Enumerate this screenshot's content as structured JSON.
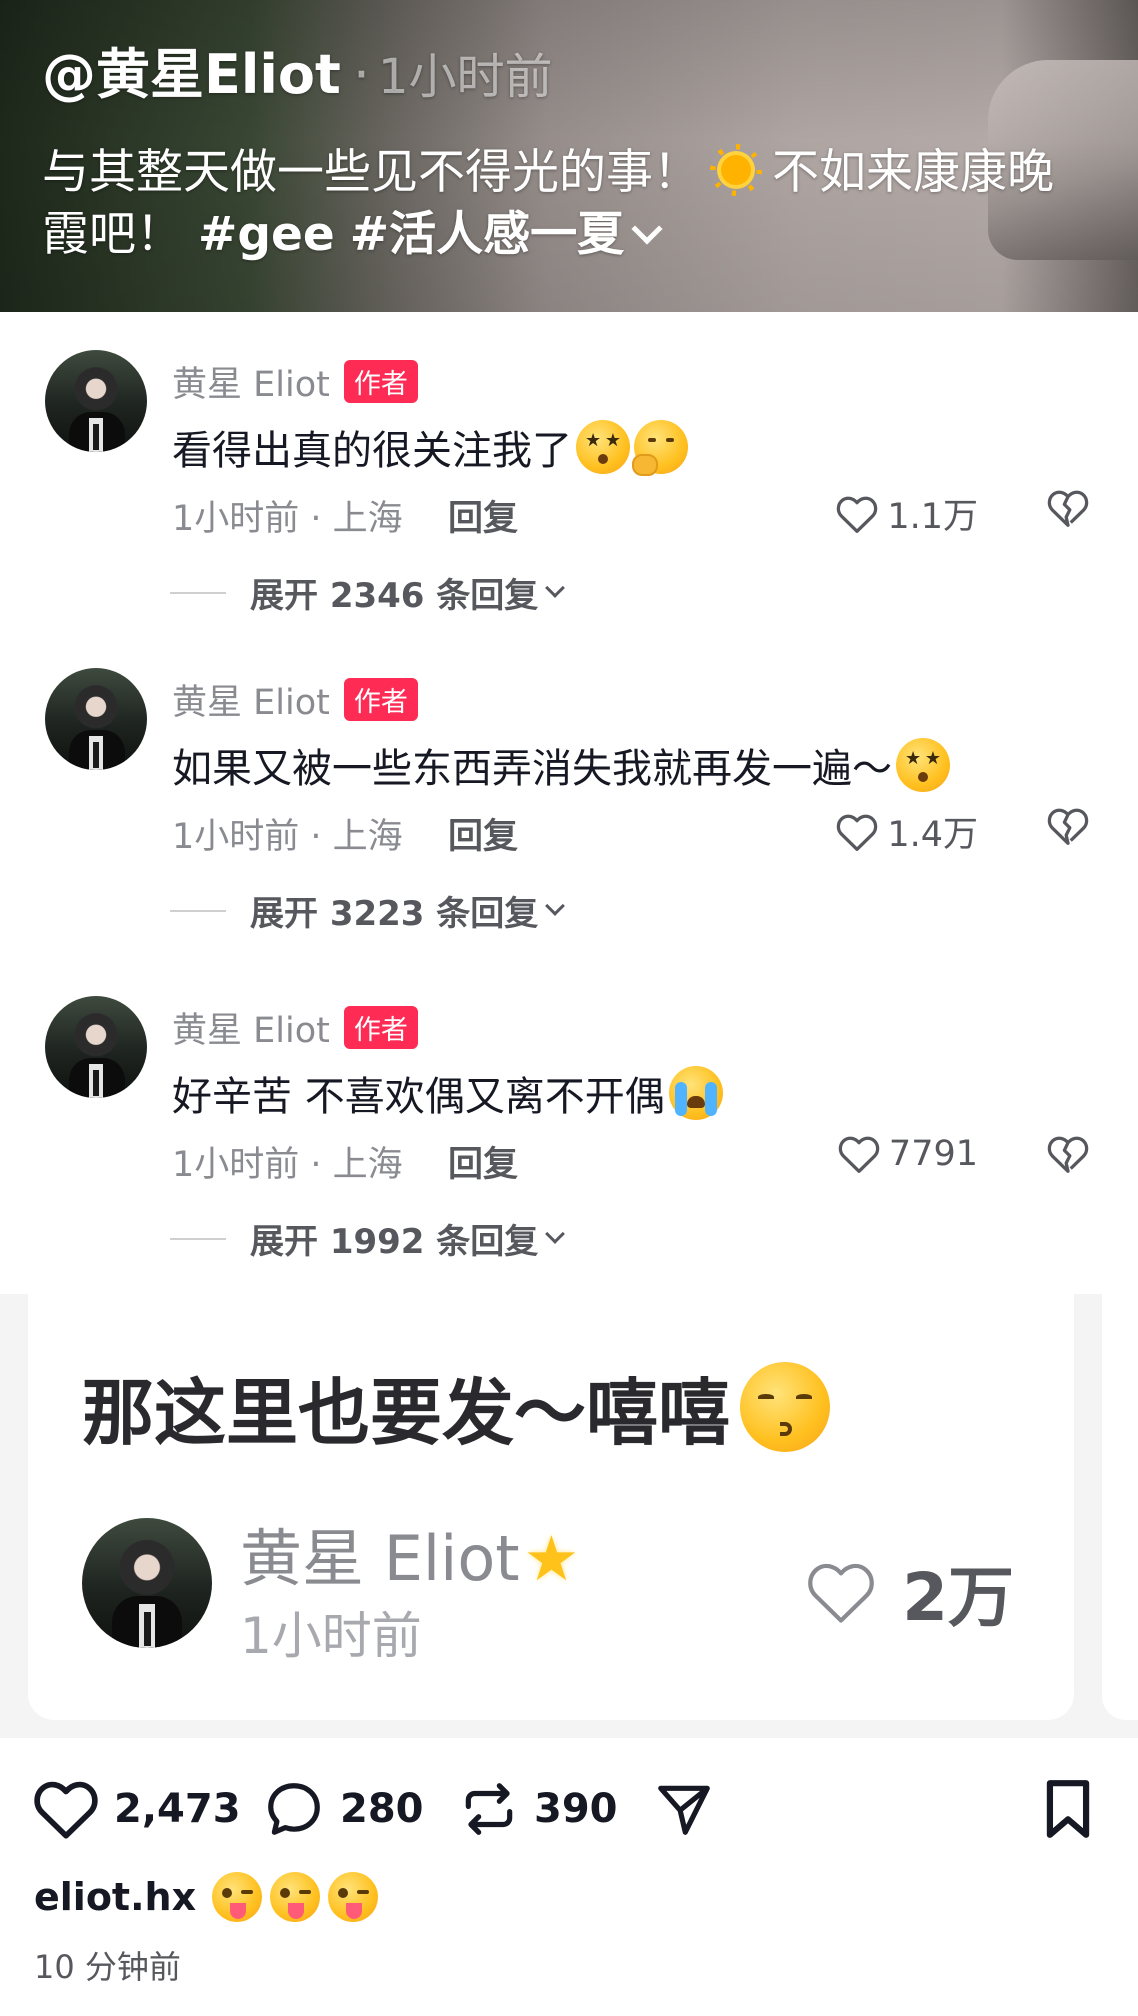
{
  "video": {
    "author": "@黄星Eliot",
    "separator": "·",
    "time": "1小时前",
    "caption_part1": "与其整天做一些见不得光的事！",
    "caption_part2": "不如来康康晚霞吧！",
    "tag1": "#gee",
    "tag2": "#活人感一夏",
    "sun_icon": "sun-emoji",
    "expand_icon": "chevron-down-icon"
  },
  "comments": [
    {
      "user": "黄星 Eliot",
      "badge": "作者",
      "text": "看得出真的很关注我了",
      "emojis": [
        "star-struck-emoji",
        "thinking-emoji"
      ],
      "time_location": "1小时前 · 上海",
      "reply": "回复",
      "likes": "1.1万",
      "expand": "展开 2346 条回复"
    },
    {
      "user": "黄星 Eliot",
      "badge": "作者",
      "text": "如果又被一些东西弄消失我就再发一遍～",
      "emojis": [
        "star-struck-emoji"
      ],
      "time_location": "1小时前 · 上海",
      "reply": "回复",
      "likes": "1.4万",
      "expand": "展开 3223 条回复"
    },
    {
      "user": "黄星 Eliot",
      "badge": "作者",
      "text": "好辛苦 不喜欢偶又离不开偶",
      "emojis": [
        "crying-emoji"
      ],
      "time_location": "1小时前 · 上海",
      "reply": "回复",
      "likes": "7791",
      "expand": "展开 1992 条回复"
    }
  ],
  "card": {
    "text": "那这里也要发～嘻嘻",
    "emoji": "kissing-emoji",
    "user": "黄星 Eliot",
    "user_icon": "star-emoji",
    "time": "1小时前",
    "likes": "2万"
  },
  "actions": {
    "likes": "2,473",
    "comments": "280",
    "reposts": "390"
  },
  "post": {
    "username": "eliot.hx",
    "emojis": [
      "tongue-wink-emoji",
      "tongue-wink-emoji",
      "tongue-wink-emoji"
    ],
    "time": "10 分钟前"
  },
  "colors": {
    "accent": "#fe2c55",
    "text_primary": "#161823",
    "text_secondary": "#8a8b91",
    "card_bg": "#f4f4f5"
  }
}
